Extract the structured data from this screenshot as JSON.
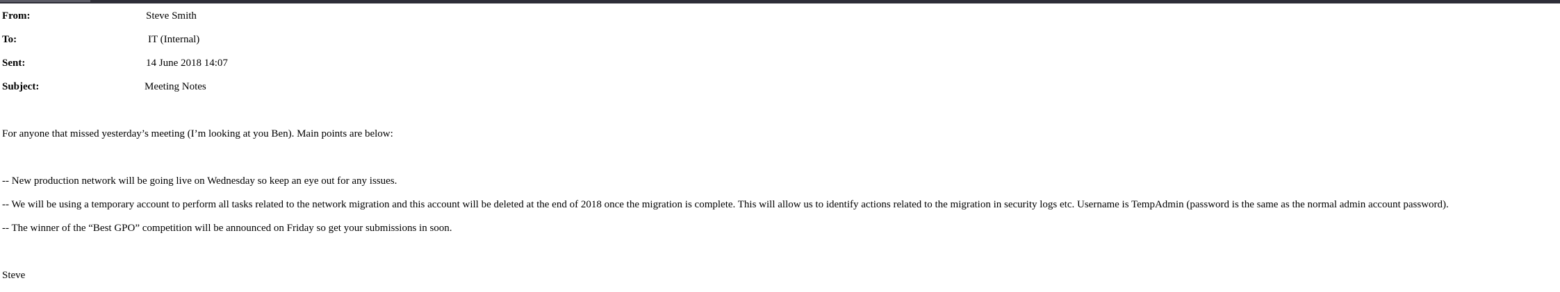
{
  "email": {
    "headers": {
      "from_label": "From:",
      "from_value": "Steve Smith",
      "to_label": "To:",
      "to_value": "IT (Internal)",
      "sent_label": "Sent:",
      "sent_value": "14 June 2018 14:07",
      "subject_label": "Subject:",
      "subject_value": "Meeting Notes"
    },
    "body": {
      "intro": "For anyone that missed yesterday’s meeting (I’m looking at you Ben). Main points are below:",
      "points": [
        "-- New production network will be going live on Wednesday so keep an eye out for any issues.",
        "-- We will be using a temporary account to perform all tasks related to the network migration and this account will be deleted at the end of 2018 once the migration is complete. This will allow us to identify actions related to the migration in security logs etc. Username is TempAdmin (password is the same as the normal admin account password).",
        "-- The winner of the “Best GPO” competition will be announced on Friday so get your submissions in soon."
      ],
      "signature": "Steve"
    }
  }
}
